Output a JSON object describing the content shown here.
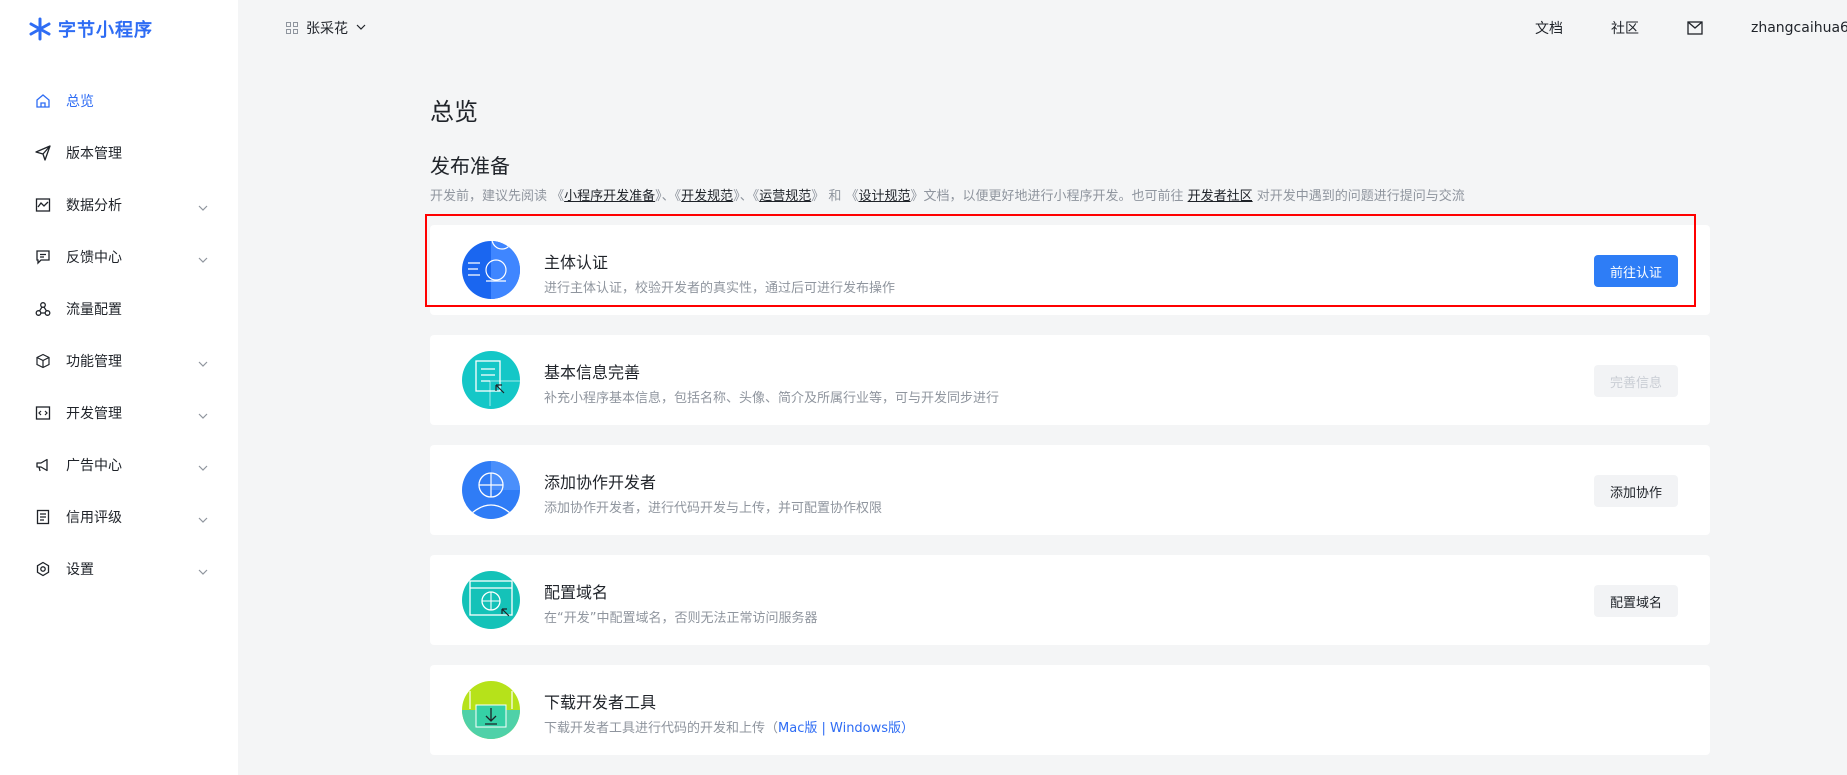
{
  "logo": {
    "text": "字节小程序"
  },
  "sidebar": {
    "items": [
      {
        "label": "总览",
        "icon": "home-icon",
        "active": true,
        "expandable": false
      },
      {
        "label": "版本管理",
        "icon": "send-icon",
        "active": false,
        "expandable": false
      },
      {
        "label": "数据分析",
        "icon": "chart-icon",
        "active": false,
        "expandable": true
      },
      {
        "label": "反馈中心",
        "icon": "message-icon",
        "active": false,
        "expandable": true
      },
      {
        "label": "流量配置",
        "icon": "share-icon",
        "active": false,
        "expandable": false
      },
      {
        "label": "功能管理",
        "icon": "cube-icon",
        "active": false,
        "expandable": true
      },
      {
        "label": "开发管理",
        "icon": "code-icon",
        "active": false,
        "expandable": true
      },
      {
        "label": "广告中心",
        "icon": "megaphone-icon",
        "active": false,
        "expandable": true
      },
      {
        "label": "信用评级",
        "icon": "document-icon",
        "active": false,
        "expandable": true
      },
      {
        "label": "设置",
        "icon": "gear-icon",
        "active": false,
        "expandable": true
      }
    ]
  },
  "header": {
    "app_name": "张采花",
    "links": {
      "docs": "文档",
      "community": "社区"
    },
    "user": "zhangcaihua6("
  },
  "main": {
    "page_title": "总览",
    "section_title": "发布准备",
    "desc": {
      "p1": "开发前，建议先阅读 《",
      "l1": "小程序开发准备",
      "p2": "》、《",
      "l2": "开发规范",
      "p3": "》、《",
      "l3": "运营规范",
      "p4": "》 和 《",
      "l4": "设计规范",
      "p5": "》文档，以便更好地进行小程序开发。也可前往 ",
      "l5": "开发者社区",
      "p6": " 对开发中遇到的问题进行提问与交流"
    },
    "cards": [
      {
        "title": "主体认证",
        "subtitle": "进行主体认证，校验开发者的真实性，通过后可进行发布操作",
        "button": "前往认证"
      },
      {
        "title": "基本信息完善",
        "subtitle": "补充小程序基本信息，包括名称、头像、简介及所属行业等，可与开发同步进行",
        "button": "完善信息"
      },
      {
        "title": "添加协作开发者",
        "subtitle": "添加协作开发者，进行代码开发与上传，并可配置协作权限",
        "button": "添加协作"
      },
      {
        "title": "配置域名",
        "subtitle": "在“开发”中配置域名，否则无法正常访问服务器",
        "button": "配置域名"
      },
      {
        "title": "下载开发者工具",
        "subtitle": "下载开发者工具进行代码的开发和上传（",
        "mac": "Mac版",
        "sep": " | ",
        "win": "Windows版",
        "close": "）"
      }
    ]
  },
  "colors": {
    "accent": "#2e6cf4",
    "highlight": "#ff0000"
  }
}
